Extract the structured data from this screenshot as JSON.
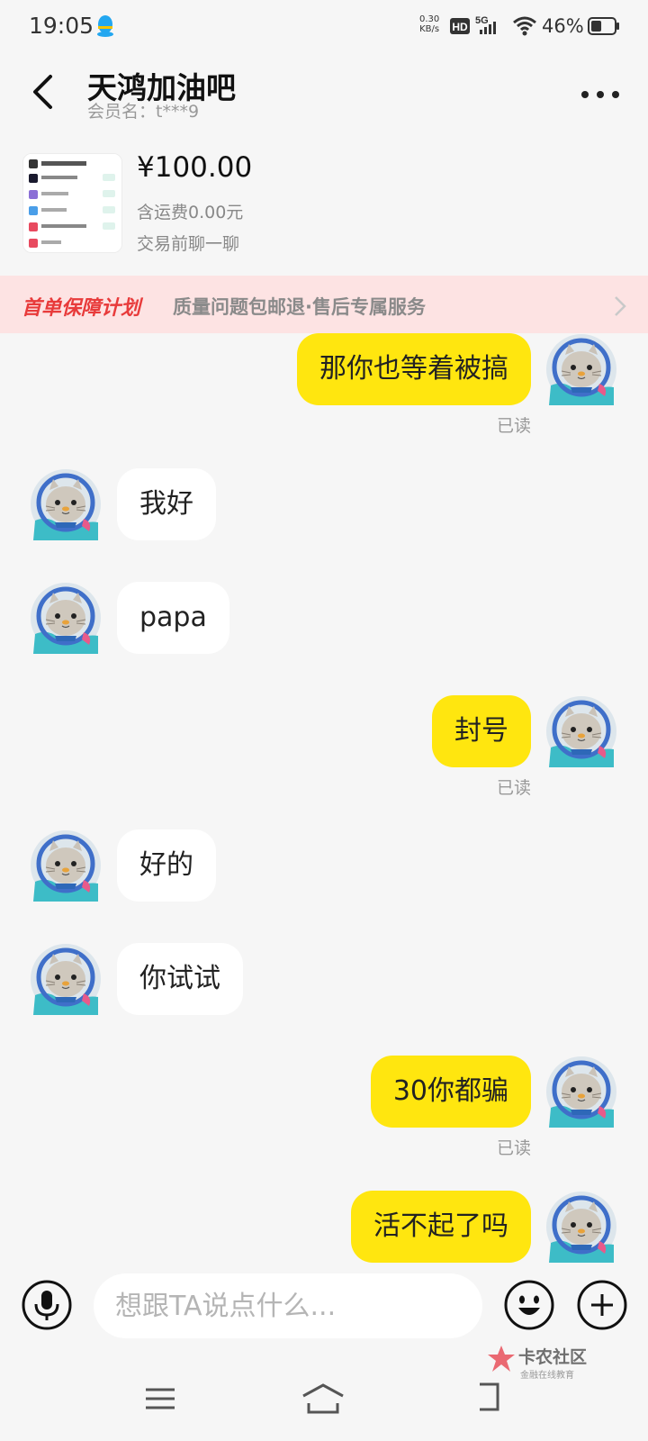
{
  "status_bar": {
    "time": "19:05",
    "net_speed_value": "0.30",
    "net_speed_unit": "KB/s",
    "hd_label": "HD",
    "network_label": "5G",
    "battery_text": "46%",
    "battery_level": 0.46
  },
  "header": {
    "title": "天鸿加油吧",
    "subtitle": "会员名：t***9"
  },
  "product": {
    "price": "¥100.00",
    "shipping": "含运费0.00元",
    "tip": "交易前聊一聊"
  },
  "banner": {
    "title": "首单保障计划",
    "description": "质量问题包邮退·售后专属服务"
  },
  "messages": [
    {
      "side": "out",
      "text": "那你也等着被搞",
      "status": "已读"
    },
    {
      "side": "in",
      "text": "我好"
    },
    {
      "side": "in",
      "text": "papa"
    },
    {
      "side": "out",
      "text": "封号",
      "status": "已读"
    },
    {
      "side": "in",
      "text": "好的"
    },
    {
      "side": "in",
      "text": "你试试"
    },
    {
      "side": "out",
      "text": "30你都骗",
      "status": "已读"
    },
    {
      "side": "out",
      "text": "活不起了吗"
    }
  ],
  "input": {
    "placeholder": "想跟TA说点什么..."
  },
  "watermark": {
    "title": "卡农社区",
    "subtitle": "金融在线教育"
  },
  "colors": {
    "outgoing_bubble": "#ffe60f",
    "incoming_bubble": "#ffffff",
    "background": "#f6f6f6",
    "banner_bg": "#fde3e3",
    "banner_title": "#e83b3b"
  }
}
